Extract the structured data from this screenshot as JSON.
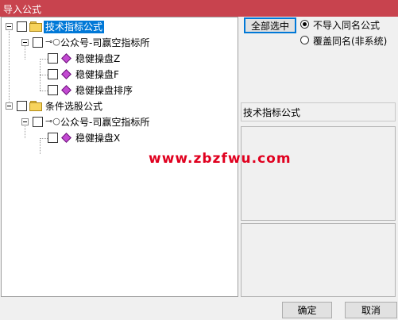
{
  "window": {
    "title": "导入公式"
  },
  "tree": {
    "nodes": [
      {
        "label": "技术指标公式",
        "selected": true
      },
      {
        "label": "公众号-司赢空指标所"
      },
      {
        "label": "稳健操盘Z"
      },
      {
        "label": "稳健操盘F"
      },
      {
        "label": "稳健操盘排序"
      },
      {
        "label": "条件选股公式"
      },
      {
        "label": "公众号-司赢空指标所"
      },
      {
        "label": "稳健操盘X"
      }
    ]
  },
  "options": {
    "select_all_label": "全部选中",
    "radio_skip_label": "不导入同名公式",
    "radio_overwrite_label": "覆盖同名(非系统)",
    "selected_radio": "不导入同名公式"
  },
  "details": {
    "formula_type": "技术指标公式"
  },
  "watermark": "www.zbzfwu.com",
  "footer": {
    "ok_label": "确定",
    "cancel_label": "取消"
  },
  "colors": {
    "titlebar": "#c8434e",
    "selection": "#0078d7",
    "watermark": "#e0001f"
  },
  "icons": {
    "category": "folder-icon",
    "source": "key-icon",
    "formula": "diamond-icon"
  }
}
